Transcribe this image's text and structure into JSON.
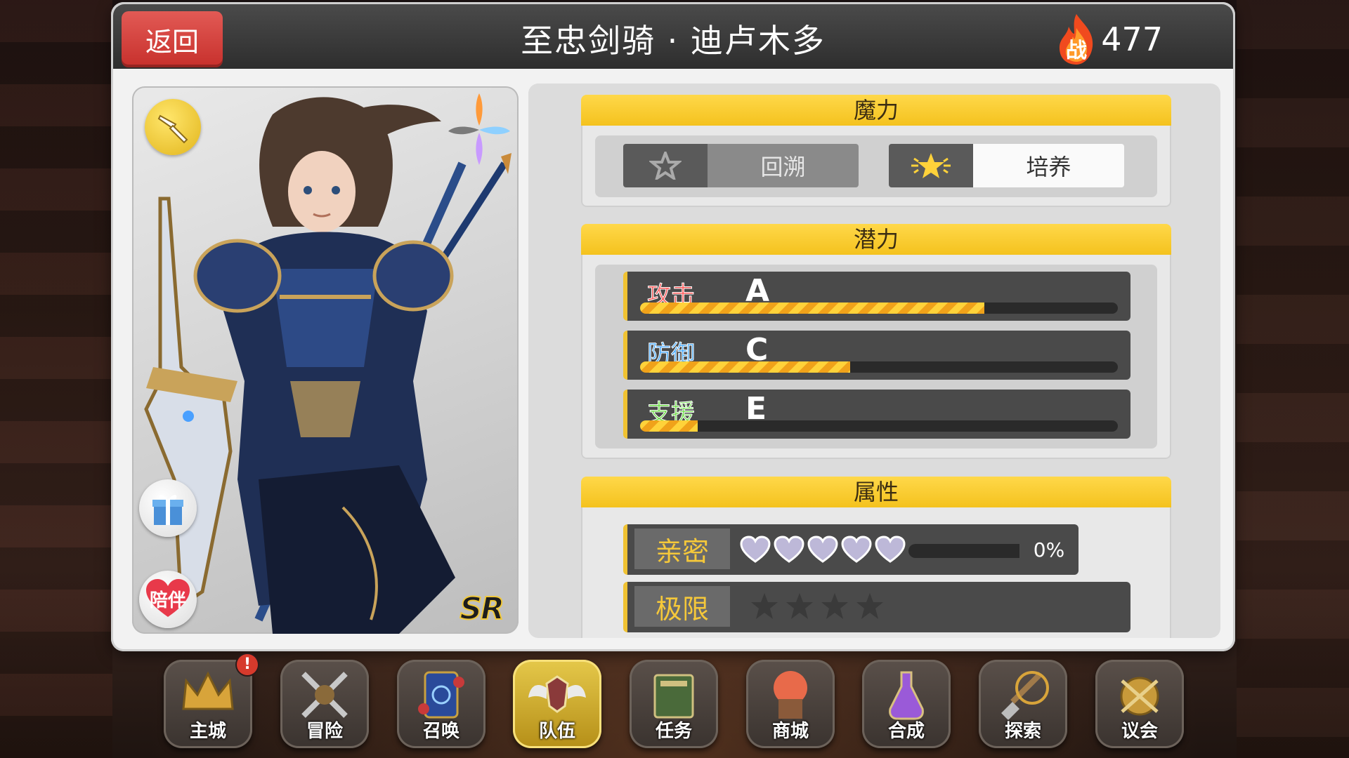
{
  "header": {
    "back_label": "返回",
    "title": "至忠剑骑 · 迪卢木多",
    "power_icon_label": "战",
    "power_value": "477"
  },
  "portrait": {
    "rarity": "SR",
    "companion_label": "陪伴",
    "class_icon": "spear-class-icon",
    "element_icon": "four-element-icon"
  },
  "mana": {
    "title": "魔力",
    "rewind_label": "回溯",
    "train_label": "培养"
  },
  "potential": {
    "title": "潜力",
    "rows": [
      {
        "name": "攻击",
        "grade": "A",
        "level": 0.72,
        "color": "#ff6a6a"
      },
      {
        "name": "防御",
        "grade": "C",
        "level": 0.44,
        "color": "#4ab0ff"
      },
      {
        "name": "支援",
        "grade": "E",
        "level": 0.12,
        "color": "#7be05a"
      }
    ]
  },
  "attributes": {
    "title": "属性",
    "intimacy_label": "亲密",
    "intimacy_hearts": 5,
    "intimacy_percent": "0%",
    "limit_label": "极限",
    "limit_stars": 4,
    "limit_filled": 0
  },
  "nav": [
    {
      "label": "主城",
      "alert": "!"
    },
    {
      "label": "冒险"
    },
    {
      "label": "召唤"
    },
    {
      "label": "队伍",
      "active": true
    },
    {
      "label": "任务"
    },
    {
      "label": "商城"
    },
    {
      "label": "合成"
    },
    {
      "label": "探索"
    },
    {
      "label": "议会"
    }
  ]
}
